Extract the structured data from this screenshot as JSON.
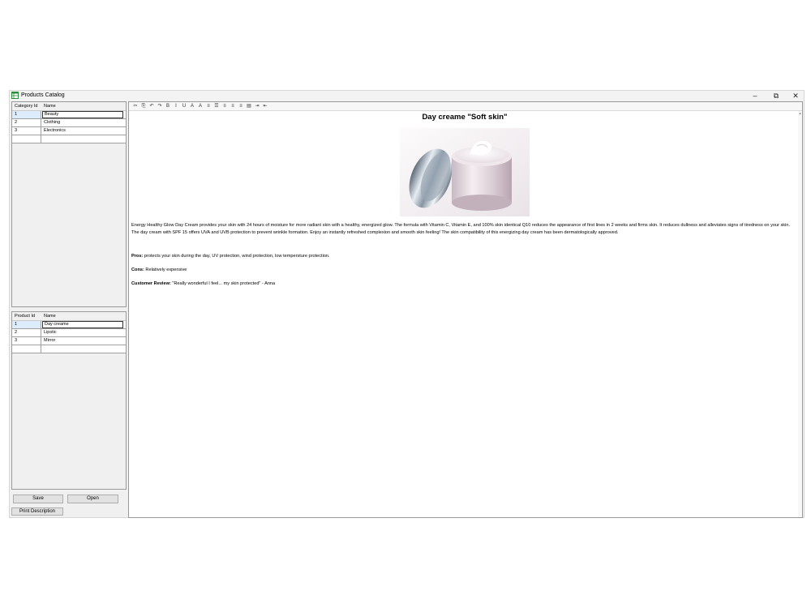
{
  "window": {
    "title": "Products Catalog",
    "controls": {
      "minimize": "–",
      "maximize": "⧉",
      "close": "✕"
    }
  },
  "categories": {
    "headers": [
      "Category Id",
      "Name"
    ],
    "rows": [
      {
        "id": "1",
        "name": "Beauty"
      },
      {
        "id": "2",
        "name": "Clothing"
      },
      {
        "id": "3",
        "name": "Electronics"
      },
      {
        "id": "",
        "name": ""
      }
    ],
    "selected_index": 0
  },
  "products": {
    "headers": [
      "Product Id",
      "Name"
    ],
    "rows": [
      {
        "id": "1",
        "name": "Day creame"
      },
      {
        "id": "2",
        "name": "Lipstic"
      },
      {
        "id": "3",
        "name": "Mirror"
      },
      {
        "id": "",
        "name": ""
      }
    ],
    "selected_index": 0
  },
  "buttons": {
    "save": "Save",
    "open": "Open",
    "print": "Print Description"
  },
  "toolbar_icons": [
    {
      "name": "cut-icon",
      "glyph": "✂"
    },
    {
      "name": "copy-icon",
      "glyph": "⎘"
    },
    {
      "name": "undo-icon",
      "glyph": "↶"
    },
    {
      "name": "redo-icon",
      "glyph": "↷"
    },
    {
      "name": "bold-icon",
      "glyph": "B"
    },
    {
      "name": "italic-icon",
      "glyph": "I"
    },
    {
      "name": "underline-icon",
      "glyph": "U"
    },
    {
      "name": "font-grow-icon",
      "glyph": "A"
    },
    {
      "name": "font-shrink-icon",
      "glyph": "A"
    },
    {
      "name": "numbered-list-icon",
      "glyph": "≡"
    },
    {
      "name": "bullet-list-icon",
      "glyph": "☰"
    },
    {
      "name": "align-left-icon",
      "glyph": "≡"
    },
    {
      "name": "align-center-icon",
      "glyph": "≡"
    },
    {
      "name": "align-right-icon",
      "glyph": "≡"
    },
    {
      "name": "align-justify-icon",
      "glyph": "▤"
    },
    {
      "name": "indent-icon",
      "glyph": "⇥"
    },
    {
      "name": "outdent-icon",
      "glyph": "⇤"
    }
  ],
  "document": {
    "title": "Day creame \"Soft skin\"",
    "description": "Energy Healthy Glow Day Cream provides your skin with 24 hours of moisture for more radiant skin with a healthy, energized glow. The formula with Vitamin C, Vitamin E, and 100% skin identical Q10 reduces the appearance of first lines in 2 weeks and firms skin. It reduces dullness and alleviates signs of tiredness on your skin. The day cream with SPF 15 offers UVA and UVB protection to prevent wrinkle formation. Enjoy an instantly refreshed complexion and smooth skin feeling! The skin compatibility of this energizing day cream has been dermatologically approved.",
    "pros_label": "Pros:",
    "pros_text": " protects your skin during the day, UV protection, wind protection, low tempersture protection.",
    "cons_label": "Cons:",
    "cons_text": " Relatively expensive",
    "review_label": "Customer Review:",
    "review_text": " \"Really wonderful I feel... my skin protected\" - Anna"
  }
}
